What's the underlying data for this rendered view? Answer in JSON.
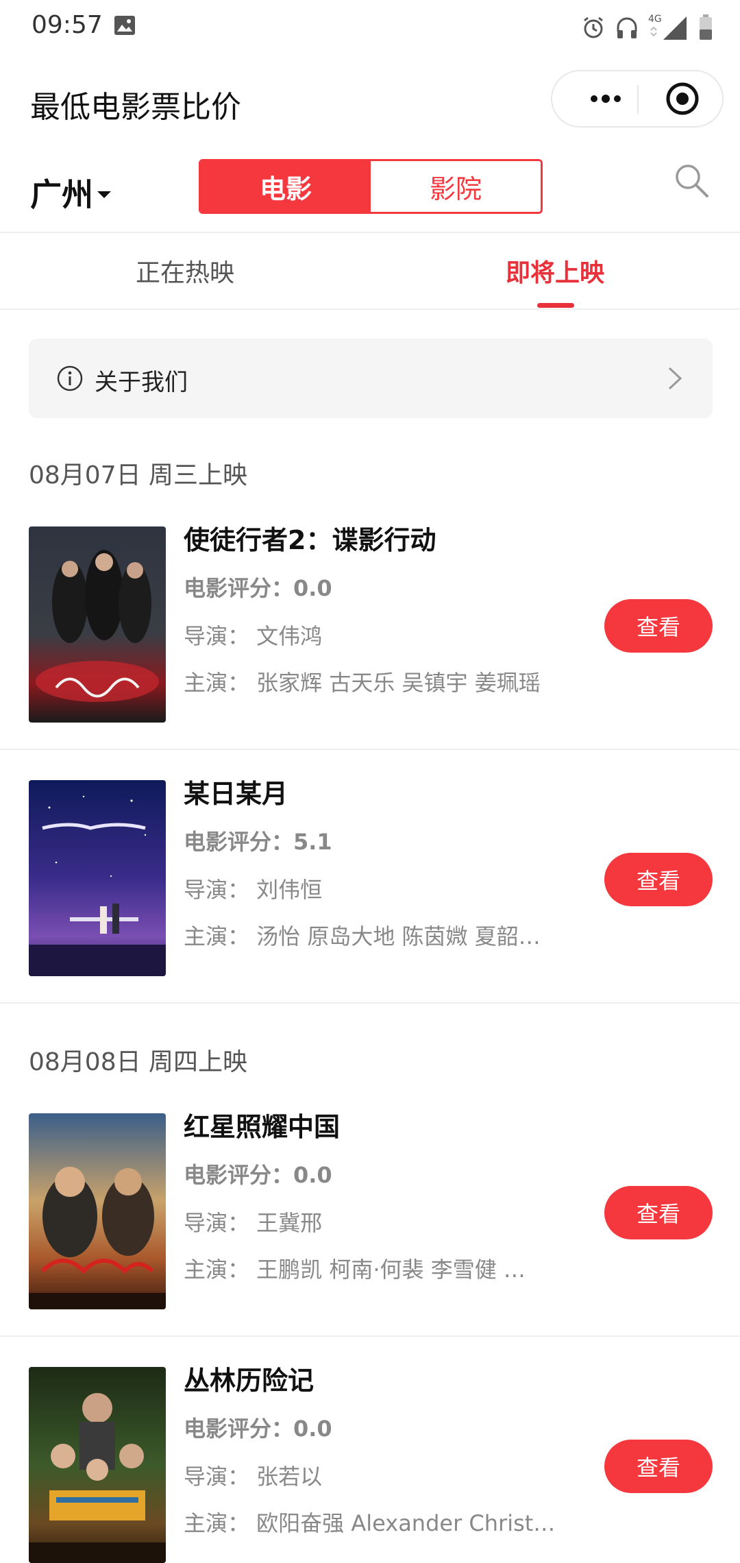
{
  "status_bar": {
    "time": "09:57",
    "network": "4G"
  },
  "header": {
    "title": "最低电影票比价"
  },
  "toolbar": {
    "city": "广州",
    "segments": [
      {
        "label": "电影",
        "active": true
      },
      {
        "label": "影院",
        "active": false
      }
    ]
  },
  "tabs": [
    {
      "label": "正在热映",
      "active": false
    },
    {
      "label": "即将上映",
      "active": true
    }
  ],
  "about": {
    "label": "关于我们"
  },
  "groups": [
    {
      "date": "08月07日 周三上映",
      "movies": [
        {
          "title": "使徒行者2：谍影行动",
          "score": "电影评分：0.0",
          "director": "导演：  文伟鸿",
          "actors": "主演：  张家辉 古天乐 吴镇宇 姜珮瑶",
          "button": "查看"
        },
        {
          "title": "某日某月",
          "score": "电影评分：5.1",
          "director": "导演：  刘伟恒",
          "actors": "主演：  汤怡 原岛大地 陈茵媺 夏韶…",
          "button": "查看"
        }
      ]
    },
    {
      "date": "08月08日 周四上映",
      "movies": [
        {
          "title": "红星照耀中国",
          "score": "电影评分：0.0",
          "director": "导演：  王冀邢",
          "actors": "主演：  王鹏凯 柯南·何裴 李雪健 …",
          "button": "查看"
        },
        {
          "title": "丛林历险记",
          "score": "电影评分：0.0",
          "director": "导演：  张若以",
          "actors": "主演：  欧阳奋强 Alexander Christ…",
          "button": "查看"
        }
      ]
    }
  ],
  "colors": {
    "accent": "#f5373e",
    "tab_active": "#e8313a",
    "muted_text": "#888888"
  }
}
